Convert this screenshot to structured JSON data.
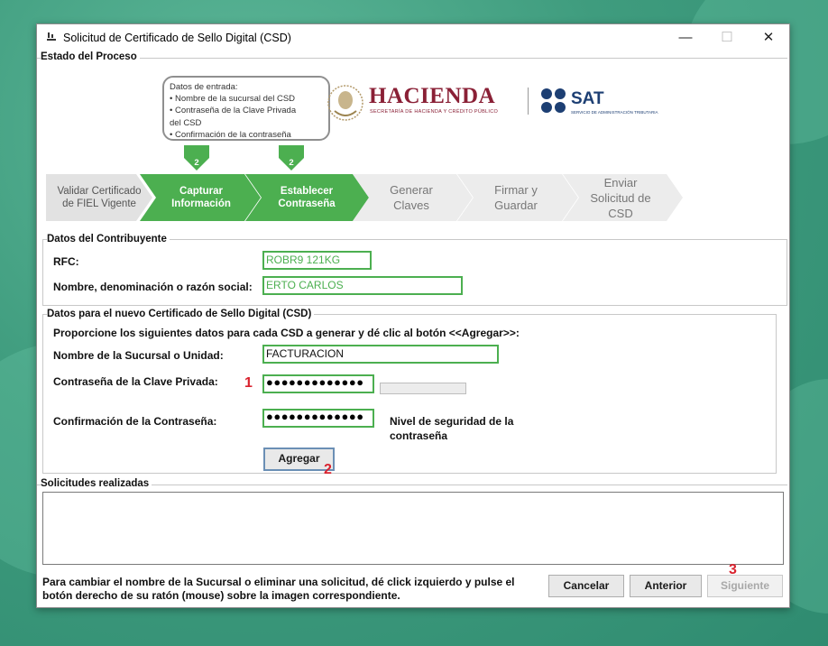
{
  "window": {
    "title": "Solicitud de Certificado de Sello Digital (CSD)",
    "minimize_glyph": "—",
    "maximize_glyph": "☐",
    "close_glyph": "✕"
  },
  "process": {
    "title": "Estado del Proceso",
    "callout": {
      "heading": "Datos de entrada:",
      "items": [
        "• Nombre de la sucursal del CSD",
        "• Contraseña de la Clave Privada",
        "del CSD",
        "• Confirmación de la contraseña"
      ]
    },
    "arrow_numbers": [
      "2",
      "2"
    ],
    "steps": [
      {
        "label_line1": "Validar Certificado",
        "label_line2": "de FIEL Vigente",
        "state": "done"
      },
      {
        "label_line1": "Capturar",
        "label_line2": "Información",
        "state": "active"
      },
      {
        "label_line1": "Establecer",
        "label_line2": "Contraseña",
        "state": "active"
      },
      {
        "label_line1": "Generar",
        "label_line2": "Claves",
        "state": "pending"
      },
      {
        "label_line1": "Firmar y",
        "label_line2": "Guardar",
        "state": "pending"
      },
      {
        "label_line1": "Enviar",
        "label_line2": "Solicitud de",
        "label_line3": "CSD",
        "state": "pending"
      }
    ],
    "logos": {
      "hacienda": "HACIENDA",
      "hacienda_sub": "SECRETARÍA DE HACIENDA Y CRÉDITO PÚBLICO",
      "sat": "SAT",
      "sat_sub": "SERVICIO DE ADMINISTRACIÓN TRIBUTARIA"
    }
  },
  "contribuyente": {
    "title": "Datos del Contribuyente",
    "rfc_label": "RFC:",
    "rfc_value": "ROBR9    121KG",
    "nombre_label": "Nombre, denominación o razón social:",
    "nombre_value": "ERTO CARLOS"
  },
  "csd": {
    "title": "Datos para el nuevo Certificado de Sello Digital (CSD)",
    "instructions": "Proporcione los siguientes datos para cada CSD a generar y dé clic al botón <<Agregar>>:",
    "sucursal_label": "Nombre de la Sucursal o Unidad:",
    "sucursal_value": "FACTURACION",
    "password_label": "Contraseña de la Clave Privada:",
    "password_value": "●●●●●●●●●●●●●",
    "confirm_label": "Confirmación de la Contraseña:",
    "confirm_value": "●●●●●●●●●●●●●",
    "security_level_line1": "Nivel de seguridad de la",
    "security_level_line2": "contraseña",
    "security_level": 0,
    "add_button": "Agregar"
  },
  "solicitudes": {
    "title": "Solicitudes realizadas"
  },
  "footer": {
    "hint": "Para cambiar el nombre de la Sucursal o eliminar una solicitud, dé click izquierdo y pulse el botón derecho de su ratón (mouse) sobre la imagen correspondiente.",
    "cancel": "Cancelar",
    "back": "Anterior",
    "next": "Siguiente"
  },
  "annotations": {
    "mark1": "1",
    "mark2": "2",
    "mark3": "3"
  },
  "colors": {
    "accent_green": "#4caf50",
    "pending_step": "#ececec",
    "hacienda_maroon": "#8a2036",
    "sat_blue": "#1d3f73",
    "annotation_red": "#d9232f"
  }
}
